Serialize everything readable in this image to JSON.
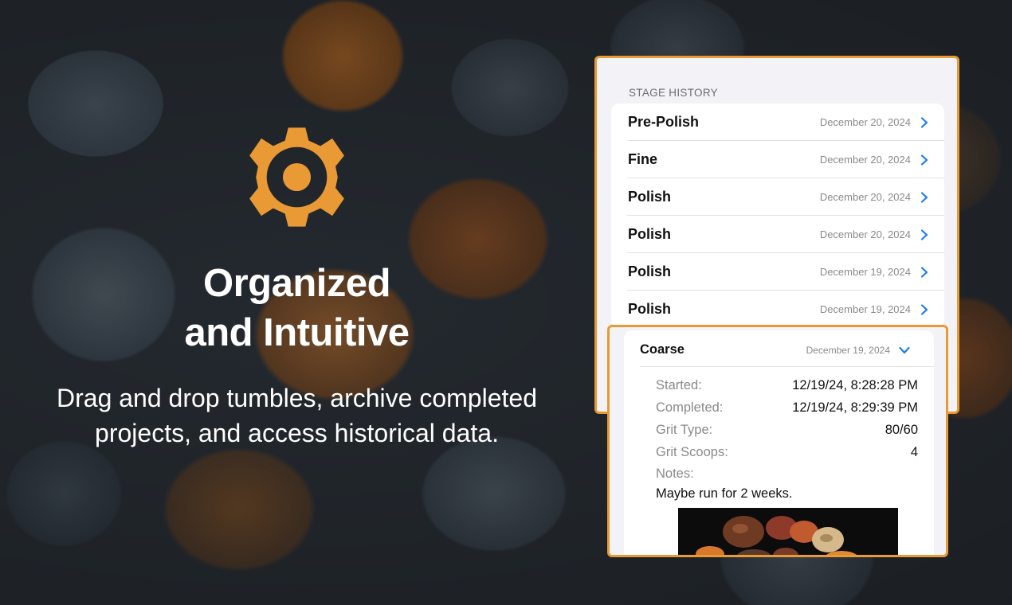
{
  "hero": {
    "title_line1": "Organized",
    "title_line2": "and Intuitive",
    "subtitle_line1": "Drag and drop tumbles, archive completed",
    "subtitle_line2": "projects, and access historical data.",
    "icon": "gear-icon",
    "accent_color": "#e99a34"
  },
  "stage_history": {
    "header": "STAGE HISTORY",
    "rows": [
      {
        "label": "Pre-Polish",
        "date": "December 20, 2024"
      },
      {
        "label": "Fine",
        "date": "December 20, 2024"
      },
      {
        "label": "Polish",
        "date": "December 20, 2024"
      },
      {
        "label": "Polish",
        "date": "December 20, 2024"
      },
      {
        "label": "Polish",
        "date": "December 19, 2024"
      },
      {
        "label": "Polish",
        "date": "December 19, 2024"
      }
    ]
  },
  "detail_card": {
    "title": "Coarse",
    "date": "December 19, 2024",
    "fields": [
      {
        "label": "Started:",
        "value": "12/19/24, 8:28:28 PM"
      },
      {
        "label": "Completed:",
        "value": "12/19/24, 8:29:39 PM"
      },
      {
        "label": "Grit Type:",
        "value": "80/60"
      },
      {
        "label": "Grit Scoops:",
        "value": "4"
      }
    ],
    "notes_label": "Notes:",
    "notes": "Maybe run for 2 weeks.",
    "link_color": "#1a7cf2"
  }
}
